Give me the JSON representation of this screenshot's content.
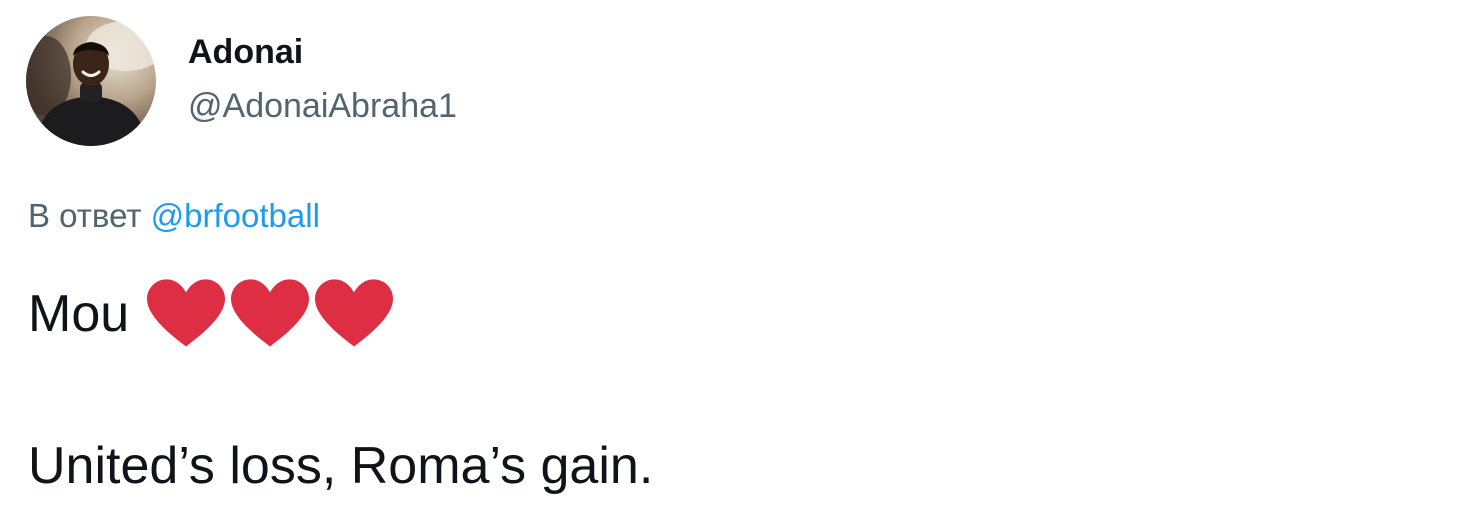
{
  "user": {
    "display_name": "Adonai",
    "handle": "@AdonaiAbraha1",
    "avatar_icon": "profile-photo"
  },
  "reply": {
    "prefix": "В ответ",
    "mention": "@brfootball"
  },
  "tweet": {
    "line1": "Mou",
    "emoji": [
      "red-heart",
      "red-heart",
      "red-heart"
    ],
    "line2": "United’s loss, Roma’s gain."
  },
  "colors": {
    "text_primary": "#0f1419",
    "text_secondary": "#536471",
    "link": "#1d9bf0",
    "heart": "#dd2e44"
  }
}
